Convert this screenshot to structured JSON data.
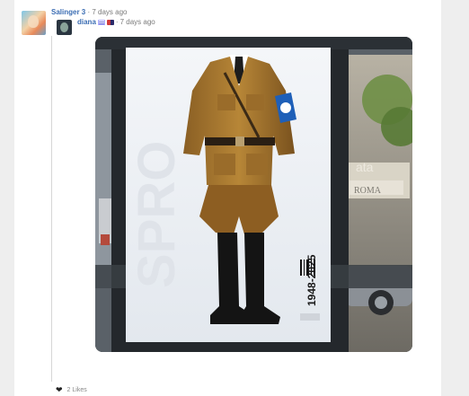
{
  "comment": {
    "username": "Salinger 3",
    "separator": " · ",
    "time": "7 days ago"
  },
  "reply": {
    "username": "diana",
    "separator": " · ",
    "time": "7 days ago",
    "flags": [
      "us-flag-icon",
      "bow-icon"
    ]
  },
  "image": {
    "poster_text": "1948-2025",
    "side_text": "SPRO",
    "sign_text": "ROMA",
    "corner_text": "ata"
  },
  "likes": {
    "label": "2 Likes"
  },
  "colors": {
    "username": "#3b6db3",
    "meta": "#7a7a7a",
    "panel": "#ffffff",
    "background": "#eeeeee"
  }
}
